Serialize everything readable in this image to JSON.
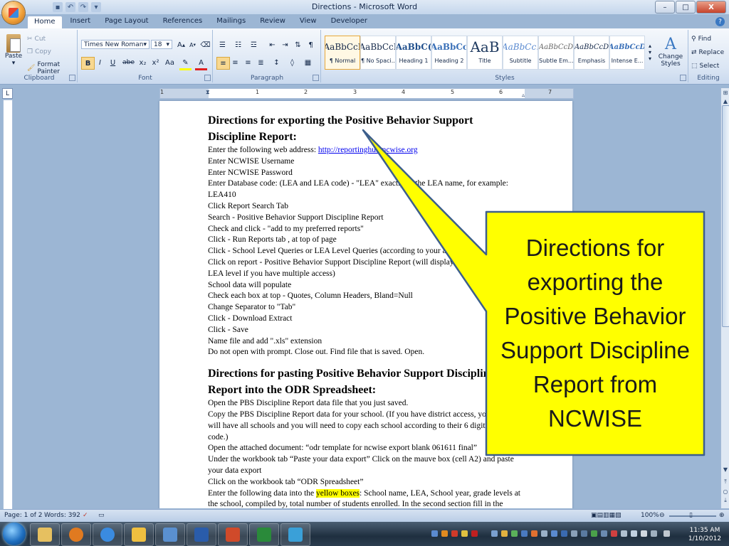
{
  "window": {
    "title": "Directions - Microsoft Word",
    "controls": {
      "minimize": "–",
      "maximize": "□",
      "close": "X"
    }
  },
  "tabs": [
    "Home",
    "Insert",
    "Page Layout",
    "References",
    "Mailings",
    "Review",
    "View",
    "Developer"
  ],
  "ribbon": {
    "clipboard": {
      "label": "Clipboard",
      "paste": "Paste",
      "cut": "Cut",
      "copy": "Copy",
      "format_painter": "Format Painter"
    },
    "font": {
      "label": "Font",
      "font_name": "Times New Roman",
      "font_size": "18",
      "bold": "B",
      "italic": "I",
      "underline": "U",
      "strike": "abe",
      "subscript": "x₂",
      "superscript": "x²",
      "change_case": "Aa",
      "grow": "A",
      "shrink": "A"
    },
    "paragraph": {
      "label": "Paragraph"
    },
    "styles": {
      "label": "Styles",
      "items": [
        {
          "preview": "AaBbCcI",
          "name": "¶ Normal"
        },
        {
          "preview": "AaBbCcI",
          "name": "¶ No Spaci..."
        },
        {
          "preview": "AaBbC(",
          "name": "Heading 1"
        },
        {
          "preview": "AaBbCc",
          "name": "Heading 2"
        },
        {
          "preview": "AaB",
          "name": "Title"
        },
        {
          "preview": "AaBbCc.",
          "name": "Subtitle"
        },
        {
          "preview": "AaBbCcD",
          "name": "Subtle Em..."
        },
        {
          "preview": "AaBbCcD",
          "name": "Emphasis"
        },
        {
          "preview": "AaBbCcD",
          "name": "Intense E..."
        }
      ],
      "change_styles": "Change Styles"
    },
    "editing": {
      "label": "Editing",
      "find": "Find",
      "replace": "Replace",
      "select": "Select"
    }
  },
  "ruler": {
    "numbers": [
      "1",
      "1",
      "2",
      "3",
      "4",
      "5",
      "6",
      "7"
    ]
  },
  "document": {
    "heading1_line1": "Directions for exporting the Positive Behavior Support",
    "heading1_line2": "Discipline Report:",
    "lines1": [
      "Enter NCWISE Username",
      "Enter NCWISE Password",
      "Enter Database code: (LEA and LEA code) - \"LEA\" exactly as the LEA name, for example:",
      "LEA410",
      "Click Report Search Tab",
      "Search - Positive Behavior Support Discipline Report",
      "Check and click - \"add to my preferred reports\"",
      "Click - Run Reports tab , at top of page",
      "Click - School Level Queries or LEA Level Queries (according to your access)",
      "Click on report - Positive Behavior Support Discipline Report (will display school or",
      "LEA level if you have multiple access)",
      "School data will populate",
      "Check each box at top - Quotes, Column Headers, Bland=Null",
      "Change Separator to \"Tab\"",
      "Click - Download Extract",
      "Click - Save",
      "Name file and add \".xls\" extension",
      "Do not open with prompt.  Close out.  Find file that is saved.  Open."
    ],
    "web_address_label": "Enter the following web address:  ",
    "web_address": "http://reportinghub.ncwise.org",
    "heading2_line1": "Directions for pasting Positive Behavior Support Discipline",
    "heading2_line2": "Report into the ODR Spreadsheet:",
    "lines2": [
      "Open the PBS Discipline Report data file that you just saved.",
      "Copy the PBS Discipline Report data for your school. (If you have district access, you",
      "will have all schools and you will need to copy each school according to their 6 digit school",
      "code.)",
      "Open the attached document: “odr template for ncwise export blank 061611 final”",
      "Under the workbook tab “Paste your data export” Click on the mauve box (cell A2) and paste",
      "your data export",
      "Click on the workbook tab “ODR Spreadsheet”"
    ],
    "last_line_pre": "Enter the following data into the ",
    "last_line_hl": "yellow boxes",
    "last_line_post": ": School name, LEA, School year, grade levels at",
    "cut_line": "the school, compiled by, total number of students enrolled. In the second section fill in the"
  },
  "callout": {
    "text": "Directions for exporting the Positive Behavior Support Discipline Report from NCWISE",
    "fill": "#ffff00",
    "border": "#3d5f8c"
  },
  "statusbar": {
    "page": "Page: 1 of 2",
    "words": "Words: 392",
    "zoom": "100%"
  },
  "taskbar": {
    "time": "11:35 AM",
    "date": "1/10/2012"
  },
  "colors": {
    "ribbon_bg": "#dbe6f4",
    "highlight": "#ffff00",
    "link": "#0000ee"
  }
}
